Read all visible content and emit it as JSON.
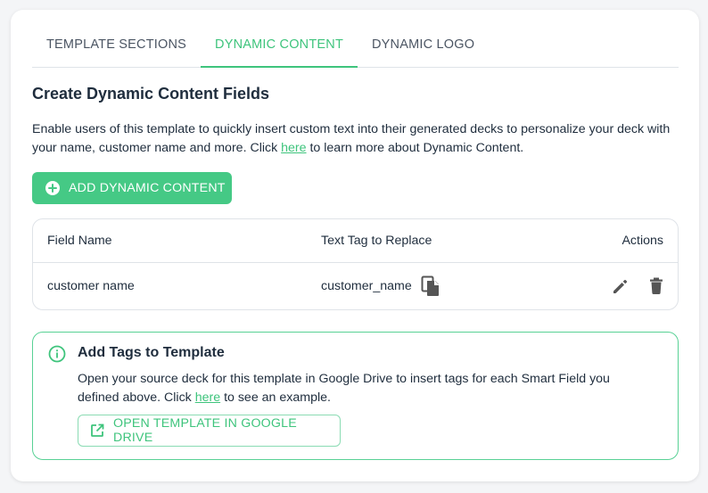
{
  "tabs": [
    {
      "label": "TEMPLATE SECTIONS",
      "active": false
    },
    {
      "label": "DYNAMIC CONTENT",
      "active": true
    },
    {
      "label": "DYNAMIC LOGO",
      "active": false
    }
  ],
  "section": {
    "title": "Create Dynamic Content Fields",
    "description_before_link": "Enable users of this template to quickly insert custom text into their generated decks to personalize your deck with your name, customer name and more. Click ",
    "description_link": "here",
    "description_after_link": " to learn more about Dynamic Content."
  },
  "add_button": {
    "label": "ADD DYNAMIC CONTENT",
    "icon": "plus-circle-icon"
  },
  "table": {
    "headers": [
      "Field Name",
      "Text Tag to Replace",
      "Actions"
    ],
    "rows": [
      {
        "field_name": "customer name",
        "text_tag": "customer_name"
      }
    ],
    "icons": {
      "copy": "copy-icon",
      "edit": "pencil-icon",
      "delete": "trash-icon"
    }
  },
  "info": {
    "title": "Add Tags to Template",
    "text_before_link": "Open your source deck for this template in Google Drive to insert tags for each Smart Field you defined above. Click ",
    "text_link": "here",
    "text_after_link": " to see an example.",
    "button_label": "OPEN TEMPLATE IN GOOGLE DRIVE",
    "icons": {
      "info": "info-icon",
      "external": "external-link-icon"
    }
  },
  "colors": {
    "accent": "#3ec47c",
    "button_fill": "#45c985",
    "text": "#1f2d3d",
    "icon_gray": "#555555"
  }
}
